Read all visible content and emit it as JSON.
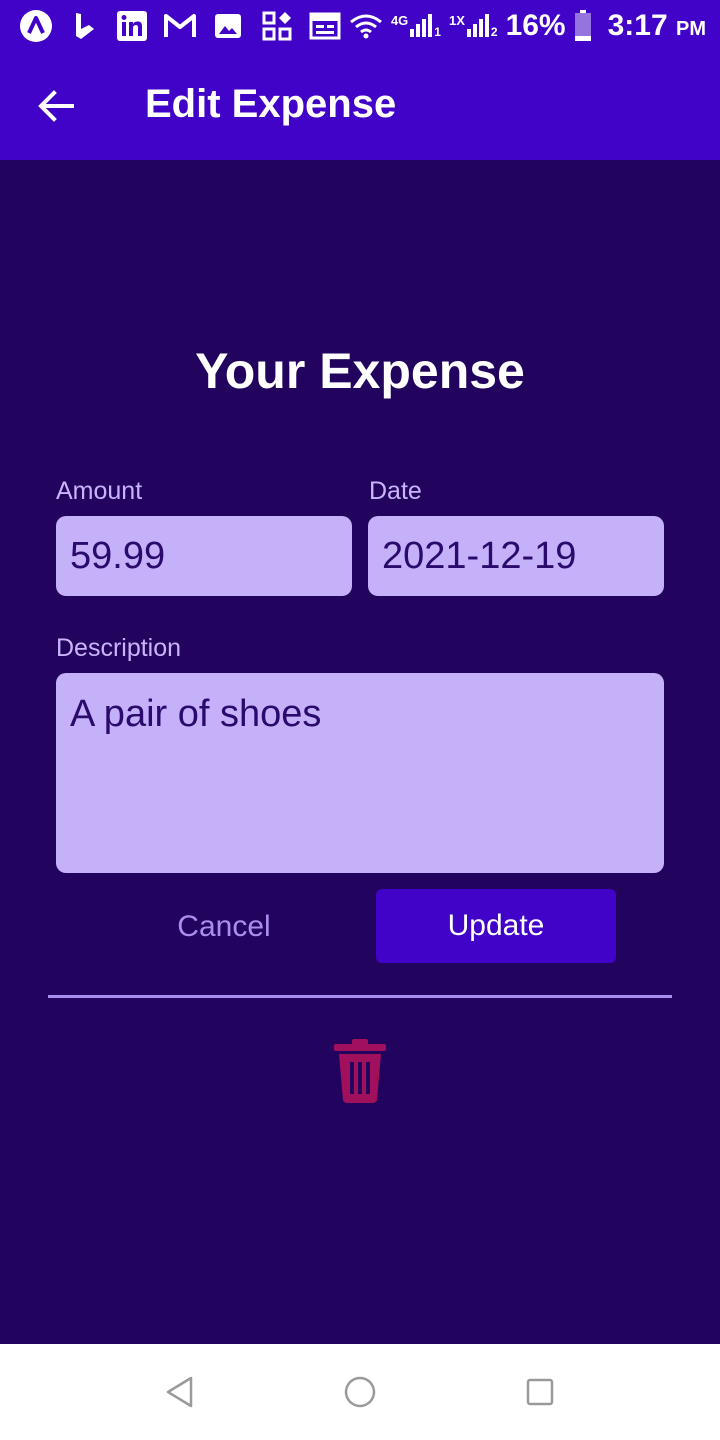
{
  "status_bar": {
    "battery_percent": "16%",
    "time": "3:17",
    "ampm": "PM",
    "network_1": "4G",
    "network_2": "1X",
    "icons": [
      "app-a-icon",
      "bing-icon",
      "linkedin-icon",
      "gmail-icon",
      "gallery-icon",
      "apps-icon",
      "calendar-icon",
      "wifi-icon",
      "signal-icon",
      "battery-icon"
    ]
  },
  "app_bar": {
    "title": "Edit Expense",
    "back_icon": "arrow-back-icon"
  },
  "form": {
    "heading": "Your Expense",
    "amount_label": "Amount",
    "amount_value": "59.99",
    "date_label": "Date",
    "date_value": "2021-12-19",
    "description_label": "Description",
    "description_value": "A pair of shoes",
    "cancel_label": "Cancel",
    "update_label": "Update",
    "delete_icon": "trash-icon"
  },
  "nav_bar": {
    "icons": [
      "back-triangle-icon",
      "home-circle-icon",
      "recents-square-icon"
    ]
  },
  "colors": {
    "background": "#22045e",
    "primary": "#4103c7",
    "field_bg": "#c5b0fa",
    "label": "#c8b4fa",
    "delete": "#a0105c"
  }
}
